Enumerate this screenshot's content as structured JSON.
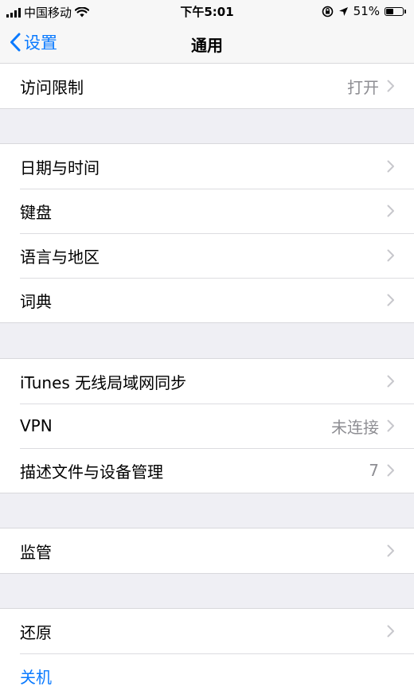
{
  "status_bar": {
    "carrier": "中国移动",
    "time": "下午5:01",
    "battery": "51%",
    "battery_level": 0.51
  },
  "nav": {
    "back_label": "设置",
    "title": "通用"
  },
  "groups": [
    [
      {
        "label": "访问限制",
        "value": "打开"
      }
    ],
    [
      {
        "label": "日期与时间",
        "value": ""
      },
      {
        "label": "键盘",
        "value": ""
      },
      {
        "label": "语言与地区",
        "value": ""
      },
      {
        "label": "词典",
        "value": ""
      }
    ],
    [
      {
        "label": "iTunes 无线局域网同步",
        "value": ""
      },
      {
        "label": "VPN",
        "value": "未连接"
      },
      {
        "label": "描述文件与设备管理",
        "value": "7"
      }
    ],
    [
      {
        "label": "监管",
        "value": ""
      }
    ],
    [
      {
        "label": "还原",
        "value": ""
      },
      {
        "label": "关机",
        "value": ""
      }
    ]
  ],
  "colors": {
    "accent": "#0a7aff",
    "background": "#efeff4",
    "secondary_text": "#8e8e93"
  }
}
